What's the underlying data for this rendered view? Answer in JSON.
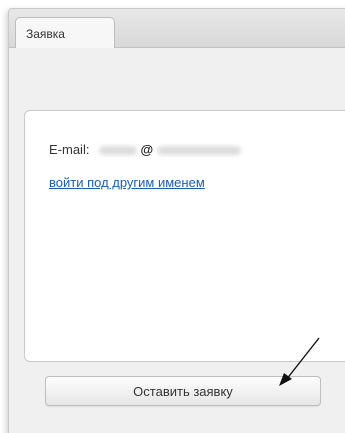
{
  "tabs": [
    {
      "label": "Заявка",
      "active": true
    }
  ],
  "form": {
    "email_label": "E-mail:",
    "email_at": "@",
    "switch_user_link": "войти под другим именем",
    "submit_label": "Оставить заявку"
  },
  "colors": {
    "link": "#1a5fb4",
    "window_background": "#f0f0f0",
    "tabbar_background": "#d8d8d8",
    "panel_background": "#ffffff"
  },
  "icons": {
    "pointer_arrow": "arrow-icon"
  }
}
